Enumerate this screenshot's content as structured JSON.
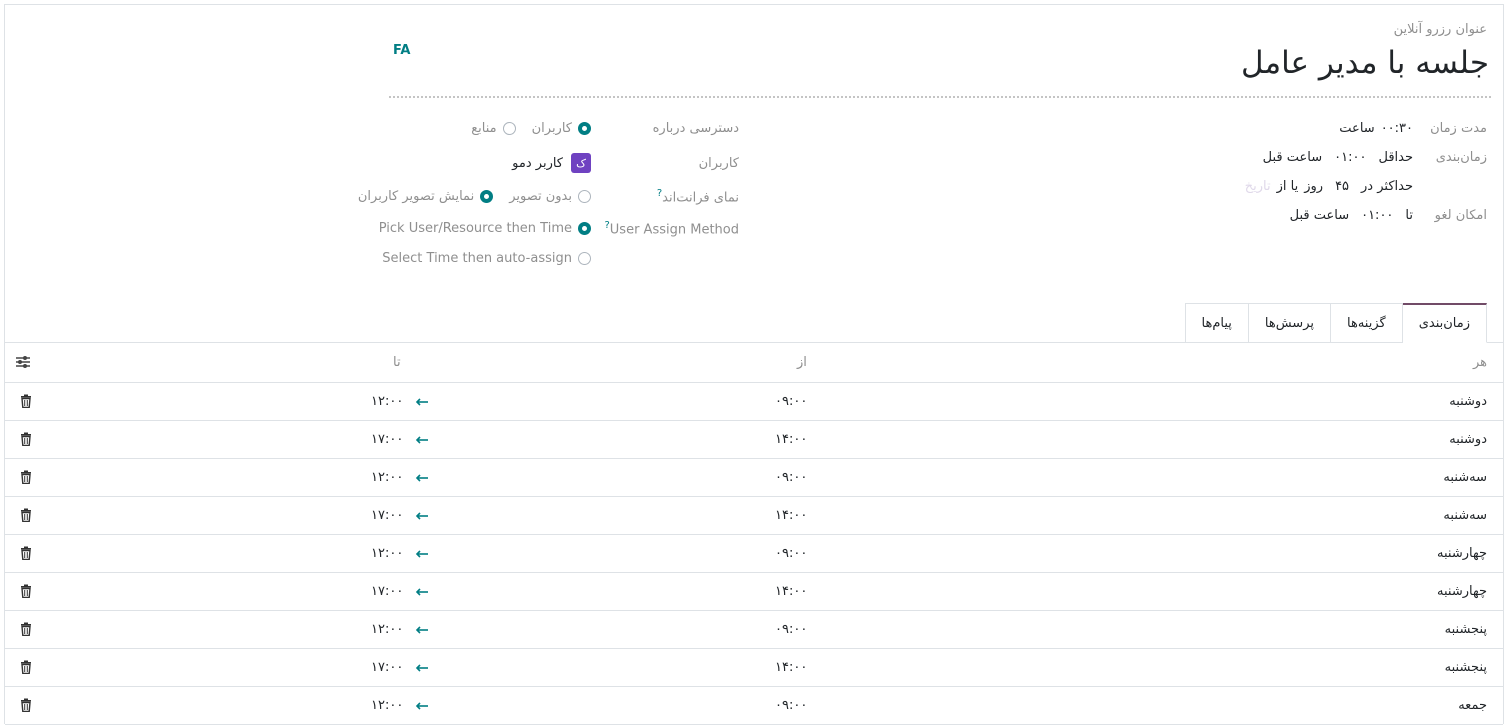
{
  "header": {
    "title_label": "عنوان رزرو آنلاین",
    "title_value": "جلسه با مدیر عامل",
    "lang_badge": "FA"
  },
  "fields_right": {
    "duration": {
      "label": "مدت زمان",
      "value": "۰۰:۳۰",
      "unit": "ساعت"
    },
    "scheduling": {
      "label": "زمان‌بندی",
      "prefix": "حداقل",
      "value": "۰۱:۰۰",
      "suffix": "ساعت قبل"
    },
    "max_window": {
      "prefix": "حداکثر در",
      "value": "۴۵",
      "mid": "روز",
      "or_from": "یا  از",
      "placeholder": "تاریخ"
    },
    "cancel": {
      "label": "امکان لغو",
      "prefix": "تا",
      "value": "۰۱:۰۰",
      "suffix": "ساعت قبل"
    }
  },
  "fields_left": {
    "availability": {
      "label": "دسترسی درباره",
      "options": [
        "کاربران",
        "منابع"
      ],
      "selected": 0
    },
    "users": {
      "label": "کاربران",
      "avatar_letter": "ک",
      "user_name": "کاربر دمو"
    },
    "frontend_view": {
      "label": "نمای فرانت‌اند",
      "help": "?",
      "options": [
        "بدون تصویر",
        "نمایش تصویر کاربران"
      ],
      "selected": 1
    },
    "assign_method": {
      "label": "User Assign Method",
      "help": "?",
      "options": [
        "Pick User/Resource then Time",
        "Select Time then auto-assign"
      ],
      "selected": 0
    }
  },
  "tabs": [
    {
      "label": "زمان‌بندی",
      "active": true
    },
    {
      "label": "گزینه‌ها",
      "active": false
    },
    {
      "label": "پرسش‌ها",
      "active": false
    },
    {
      "label": "پیام‌ها",
      "active": false
    }
  ],
  "table": {
    "headers": {
      "every": "هر",
      "from": "از",
      "to": "تا"
    },
    "rows": [
      {
        "day": "دوشنبه",
        "from": "۰۹:۰۰",
        "to": "۱۲:۰۰"
      },
      {
        "day": "دوشنبه",
        "from": "۱۴:۰۰",
        "to": "۱۷:۰۰"
      },
      {
        "day": "سه‌شنبه",
        "from": "۰۹:۰۰",
        "to": "۱۲:۰۰"
      },
      {
        "day": "سه‌شنبه",
        "from": "۱۴:۰۰",
        "to": "۱۷:۰۰"
      },
      {
        "day": "چهارشنبه",
        "from": "۰۹:۰۰",
        "to": "۱۲:۰۰"
      },
      {
        "day": "چهارشنبه",
        "from": "۱۴:۰۰",
        "to": "۱۷:۰۰"
      },
      {
        "day": "پنجشنبه",
        "from": "۰۹:۰۰",
        "to": "۱۲:۰۰"
      },
      {
        "day": "پنجشنبه",
        "from": "۱۴:۰۰",
        "to": "۱۷:۰۰"
      },
      {
        "day": "جمعه",
        "from": "۰۹:۰۰",
        "to": "۱۲:۰۰"
      }
    ]
  },
  "colors": {
    "accent": "#017e84",
    "tab_active": "#714b67",
    "avatar": "#6f42c1"
  },
  "icons": {
    "settings": "sliders-icon",
    "delete": "trash-icon",
    "arrow": "arrow-left-icon"
  }
}
